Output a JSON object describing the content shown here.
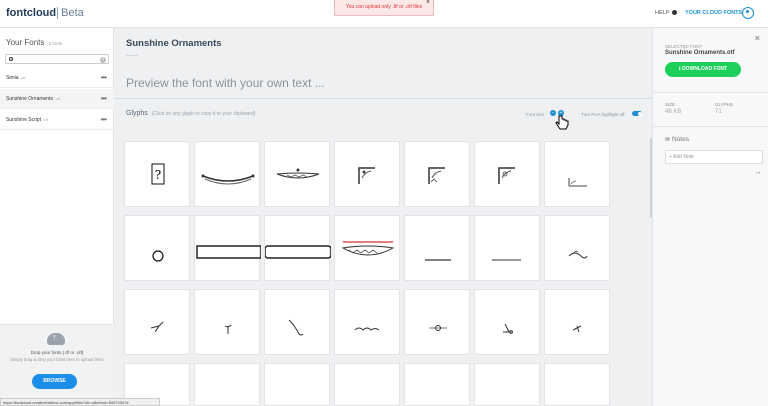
{
  "header": {
    "logo": "fontcloud",
    "beta": "Beta",
    "alert": "You can upload only .ttf or .otf files",
    "alert_close": "×",
    "help": "HELP",
    "your_cloud_fonts": "YOUR CLOUD FONTS"
  },
  "sidebar": {
    "title": "Your Fonts",
    "count": "3 fonts",
    "search_placeholder": "",
    "clear": "×",
    "fonts": [
      {
        "name": "Simia",
        "ext": ".otf",
        "more": "•••"
      },
      {
        "name": "Sunshine Ornaments",
        "ext": ".otf",
        "more": "•••"
      },
      {
        "name": "Sunshine Script",
        "ext": ".otf",
        "more": "•••"
      }
    ],
    "upload": {
      "title": "Drop your fonts (.ttf or .otf)",
      "subtitle": "Simply drag & drop your fonts here to upload them",
      "button": "BROWSE"
    }
  },
  "main": {
    "font_title": "Sunshine Ornaments",
    "font_subtitle": "——",
    "preview_placeholder": "Preview the font with your own text ...",
    "glyphs_label": "Glyphs",
    "glyphs_hint": "(Click on any glyph to copy it to your clipboard)",
    "font_size_label": "Font size",
    "minus": "−",
    "plus": "+",
    "pua_label": "Turn PUA highlight off",
    "glyphs": [
      "?",
      "",
      "",
      "",
      "",
      "",
      "",
      "○",
      "",
      "",
      "",
      "",
      "",
      "",
      "",
      "",
      "",
      "",
      "",
      "",
      ""
    ]
  },
  "right": {
    "selected_label": "SELECTED FONT",
    "selected_name": "Sunshine Ornaments.otf",
    "close": "×",
    "download": "DOWNLOAD FONT",
    "size_label": "SIZE",
    "size_value": "48 KB",
    "glyphs_label": "GLYPHS",
    "glyphs_value": "71",
    "notes": "Notes",
    "add_note": "+ Add Note",
    "arrow": "→"
  },
  "status": {
    "url": "https://fontcloud.creativefabrica.com/app/files?dir=cfb#hed=50870007#"
  },
  "colors": {
    "accent": "#1e8fd6",
    "download": "#1ed05b",
    "alert_text": "#dd3333"
  }
}
